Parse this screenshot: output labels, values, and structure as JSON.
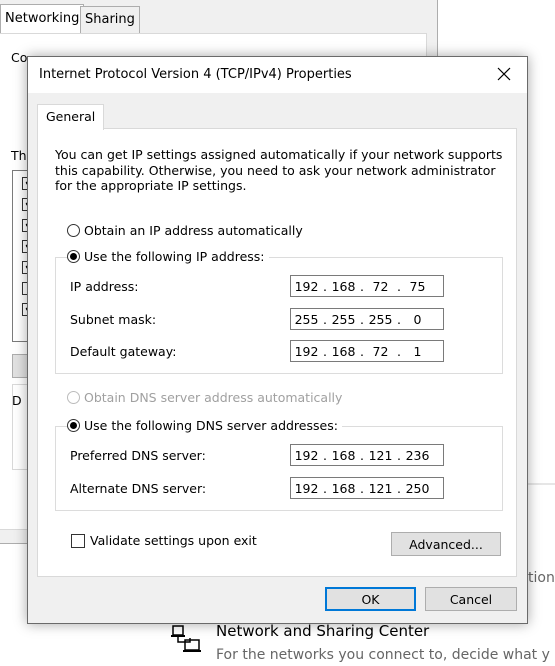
{
  "background_window": {
    "tabs": [
      "Networking",
      "Sharing"
    ],
    "fragments": [
      "Co",
      "Th",
      "D"
    ]
  },
  "background_page": {
    "cut_text": "tion",
    "link_title": "Network and Sharing Center",
    "link_desc": "For the networks you connect to, decide what y"
  },
  "dialog": {
    "title": "Internet Protocol Version 4 (TCP/IPv4) Properties",
    "tab": "General",
    "intro": "You can get IP settings assigned automatically if your network supports this capability. Otherwise, you need to ask your network administrator for the appropriate IP settings.",
    "ip_auto_label": "Obtain an IP address automatically",
    "ip_auto_selected": false,
    "ip_manual_label": "Use the following IP address:",
    "ip_manual_selected": true,
    "fields": {
      "ip_address": {
        "label": "IP address:",
        "octets": [
          "192",
          "168",
          "72",
          "75"
        ]
      },
      "subnet_mask": {
        "label": "Subnet mask:",
        "octets": [
          "255",
          "255",
          "255",
          "0"
        ]
      },
      "default_gateway": {
        "label": "Default gateway:",
        "octets": [
          "192",
          "168",
          "72",
          "1"
        ]
      },
      "preferred_dns": {
        "label": "Preferred DNS server:",
        "octets": [
          "192",
          "168",
          "121",
          "236"
        ]
      },
      "alternate_dns": {
        "label": "Alternate DNS server:",
        "octets": [
          "192",
          "168",
          "121",
          "250"
        ]
      }
    },
    "dns_auto_label": "Obtain DNS server address automatically",
    "dns_auto_enabled": false,
    "dns_manual_label": "Use the following DNS server addresses:",
    "dns_manual_selected": true,
    "validate_label": "Validate settings upon exit",
    "validate_checked": false,
    "advanced_button": "Advanced...",
    "ok_button": "OK",
    "cancel_button": "Cancel"
  },
  "colors": {
    "accent": "#0078d7",
    "dialog_bg": "#f0f0f0",
    "button_bg": "#e1e1e1"
  }
}
